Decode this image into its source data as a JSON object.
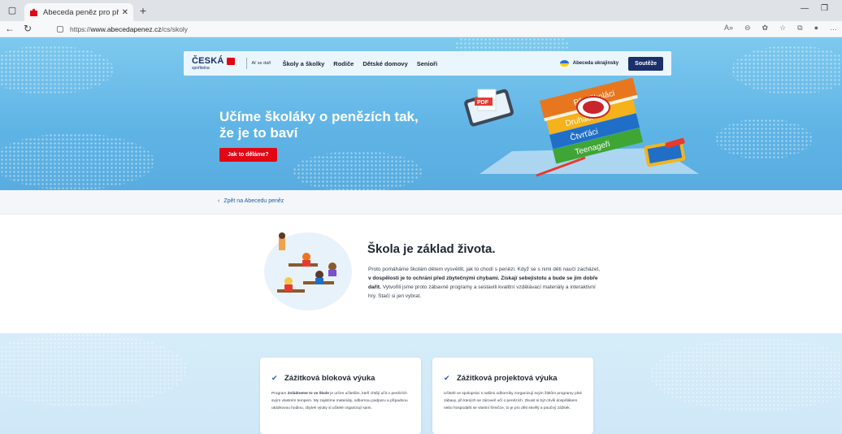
{
  "browser": {
    "tab_title": "Abeceda peněz pro předškoláky",
    "url_prefix": "https://",
    "url_host": "www.abecedapenez.cz",
    "url_path": "/cs/skoly"
  },
  "nav": {
    "brand_line1": "ČESKÁ",
    "brand_line2": "spořitelna",
    "slogan": "Ať se daří",
    "links": [
      "Školy a školky",
      "Rodiče",
      "Dětské domovy",
      "Senioři"
    ],
    "ukraine_link": "Abeceda ukrajinsky",
    "contest_button": "Soutěže"
  },
  "hero": {
    "headline": "Učíme školáky o penězích tak, že je to baví",
    "cta": "Jak to děláme?",
    "books": [
      "Předškoláci",
      "Druháci",
      "Čtvrťáci",
      "Teenageři"
    ],
    "pdf_label": "PDF",
    "stamp_text": "ABECEDA PENĚZ"
  },
  "back_link": "Zpět na Abecedu peněz",
  "intro": {
    "title": "Škola je základ života.",
    "p1": "Proto pomáháme školám dětem vysvětlit, jak to chodí s penězi. Když se s nimi děti naučí zacházet,",
    "p1_bold": "v dospělosti je to ochrání před zbytečnými chybami. Získají sebejistotu a bude se jim dobře dařit.",
    "p2": "Vytvořili jsme proto zábavné programy a sestavili kvalitní vzdělávací materiály a interaktivní hry. Stačí si jen vybrat."
  },
  "cards": [
    {
      "title": "Zážitková bloková výuka",
      "text_pre": "Program ",
      "text_bold": "Zvládneme to ve škole",
      "text_post": " je určen učitelům, kteří chtějí učit o penězích svým vlastním tempem. My zajistíme materiály, odbornou podporu a případnou ukázkovou hodinu, zbytek výuky si učitelé organizují sami."
    },
    {
      "title": "Zážitková projektová výuka",
      "text_pre": "Učitelé ve spolupráci s našimi odborníky zorganizují svým žákům programy plné zábavy, při kterých se zároveň učí o penězích. Zkusit si být chvíli dospělákem nebo hospodařit se vlastní firmičce, to je pro děti skvělý a poučný zážitek.",
      "text_bold": "",
      "text_post": ""
    }
  ],
  "colors": {
    "brand_navy": "#1b2f6a",
    "cta_red": "#e30613",
    "hero_sky": "#66b9e8",
    "link_blue": "#1c5ea8"
  }
}
